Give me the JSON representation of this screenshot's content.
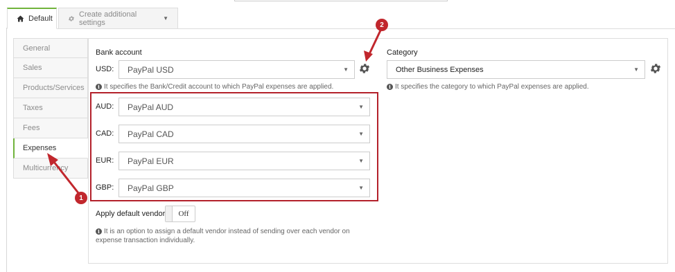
{
  "tabs": [
    {
      "label": "Default",
      "icon": "home-icon",
      "active": true
    },
    {
      "label": "Create additional settings",
      "icon": "gear-icon"
    }
  ],
  "sidebar": {
    "items": [
      {
        "label": "General"
      },
      {
        "label": "Sales"
      },
      {
        "label": "Products/Services"
      },
      {
        "label": "Taxes"
      },
      {
        "label": "Fees"
      },
      {
        "label": "Expenses",
        "active": true
      },
      {
        "label": "Multicurrency"
      }
    ]
  },
  "bank_account": {
    "title": "Bank account",
    "usd": {
      "currency": "USD:",
      "value": "PayPal USD"
    },
    "help": "It specifies the Bank/Credit account to which PayPal expenses are applied.",
    "currencies": [
      {
        "currency": "AUD:",
        "value": "PayPal AUD"
      },
      {
        "currency": "CAD:",
        "value": "PayPal CAD"
      },
      {
        "currency": "EUR:",
        "value": "PayPal EUR"
      },
      {
        "currency": "GBP:",
        "value": "PayPal GBP"
      }
    ]
  },
  "category": {
    "title": "Category",
    "value": "Other Business Expenses",
    "help": "It specifies the category to which PayPal expenses are applied."
  },
  "default_vendor": {
    "label": "Apply default vendor",
    "toggle": "Off",
    "help_line1": "It is an option to assign a default vendor instead of sending over each vendor on",
    "help_line2": "expense transaction individually."
  },
  "callouts": [
    {
      "number": "1"
    },
    {
      "number": "2"
    }
  ],
  "colors": {
    "accent_green": "#70b33b",
    "callout_red": "#c1272d"
  }
}
